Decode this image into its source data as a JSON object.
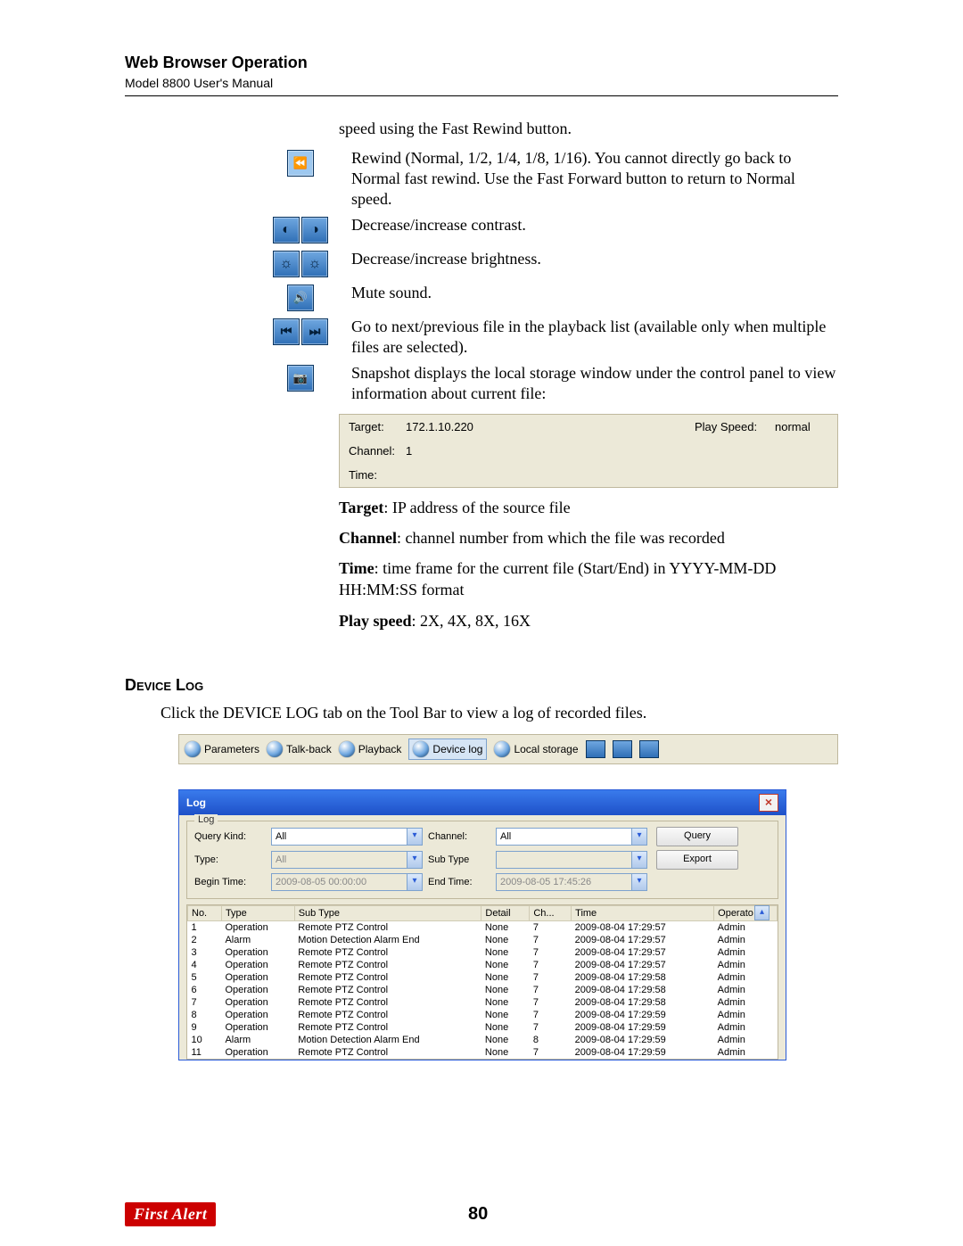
{
  "header": {
    "title": "Web Browser Operation",
    "subtitle": "Model 8800 User's Manual"
  },
  "buttons": {
    "lead_text": "speed using the Fast Rewind button.",
    "rewind_hint": "Rewind (Normal, 1/2, 1/4, 1/8, 1/16). You cannot directly go back to Normal fast rewind. Use the Fast Forward button to return to Normal speed.",
    "contrast": "Decrease/increase contrast.",
    "brightness": "Decrease/increase brightness.",
    "mute": "Mute sound.",
    "nextprev": "Go to next/previous file in the playback list (available only when multiple files are selected).",
    "snapshot": "Snapshot displays the local storage window under the control panel to view information about current file:"
  },
  "snapshot_panel": {
    "target_label": "Target:",
    "target_value": "172.1.10.220",
    "channel_label": "Channel:",
    "channel_value": "1",
    "time_label": "Time:",
    "time_value": "",
    "playspeed_label": "Play Speed:",
    "playspeed_value": "normal"
  },
  "definitions": {
    "target_b": "Target",
    "target_t": ": IP address of the source file",
    "channel_b": "Channel",
    "channel_t": ": channel number from which the file was recorded",
    "time_b": "Time",
    "time_t": ": time frame for the current file (Start/End) in YYYY-MM-DD HH:MM:SS format",
    "play_b": "Play speed",
    "play_t": ": 2X, 4X, 8X, 16X"
  },
  "device_log": {
    "heading": "Device Log",
    "intro": "Click the DEVICE LOG tab on the Tool Bar to view a log of recorded files."
  },
  "toolbar": {
    "parameters": "Parameters",
    "talkback": "Talk-back",
    "playback": "Playback",
    "devicelog": "Device log",
    "localstorage": "Local storage"
  },
  "logwin": {
    "title": "Log",
    "legend": "Log",
    "labels": {
      "query_kind": "Query Kind:",
      "channel": "Channel:",
      "type": "Type:",
      "sub_type": "Sub Type",
      "begin_time": "Begin Time:",
      "end_time": "End Time:"
    },
    "values": {
      "query_kind": "All",
      "channel": "All",
      "type": "All",
      "sub_type": "",
      "begin_time": "2009-08-05 00:00:00",
      "end_time": "2009-08-05 17:45:26"
    },
    "buttons": {
      "query": "Query",
      "export": "Export"
    },
    "columns": {
      "no": "No.",
      "type": "Type",
      "sub": "Sub Type",
      "detail": "Detail",
      "ch": "Ch...",
      "time": "Time",
      "op": "Operato"
    },
    "rows": [
      {
        "no": "1",
        "type": "Operation",
        "sub": "Remote PTZ Control",
        "detail": "None",
        "ch": "7",
        "time": "2009-08-04 17:29:57",
        "op": "Admin"
      },
      {
        "no": "2",
        "type": "Alarm",
        "sub": "Motion Detection Alarm End",
        "detail": "None",
        "ch": "7",
        "time": "2009-08-04 17:29:57",
        "op": "Admin"
      },
      {
        "no": "3",
        "type": "Operation",
        "sub": "Remote PTZ Control",
        "detail": "None",
        "ch": "7",
        "time": "2009-08-04 17:29:57",
        "op": "Admin"
      },
      {
        "no": "4",
        "type": "Operation",
        "sub": "Remote PTZ Control",
        "detail": "None",
        "ch": "7",
        "time": "2009-08-04 17:29:57",
        "op": "Admin"
      },
      {
        "no": "5",
        "type": "Operation",
        "sub": "Remote PTZ Control",
        "detail": "None",
        "ch": "7",
        "time": "2009-08-04 17:29:58",
        "op": "Admin"
      },
      {
        "no": "6",
        "type": "Operation",
        "sub": "Remote PTZ Control",
        "detail": "None",
        "ch": "7",
        "time": "2009-08-04 17:29:58",
        "op": "Admin"
      },
      {
        "no": "7",
        "type": "Operation",
        "sub": "Remote PTZ Control",
        "detail": "None",
        "ch": "7",
        "time": "2009-08-04 17:29:58",
        "op": "Admin"
      },
      {
        "no": "8",
        "type": "Operation",
        "sub": "Remote PTZ Control",
        "detail": "None",
        "ch": "7",
        "time": "2009-08-04 17:29:59",
        "op": "Admin"
      },
      {
        "no": "9",
        "type": "Operation",
        "sub": "Remote PTZ Control",
        "detail": "None",
        "ch": "7",
        "time": "2009-08-04 17:29:59",
        "op": "Admin"
      },
      {
        "no": "10",
        "type": "Alarm",
        "sub": "Motion Detection Alarm End",
        "detail": "None",
        "ch": "8",
        "time": "2009-08-04 17:29:59",
        "op": "Admin"
      },
      {
        "no": "11",
        "type": "Operation",
        "sub": "Remote PTZ Control",
        "detail": "None",
        "ch": "7",
        "time": "2009-08-04 17:29:59",
        "op": "Admin"
      }
    ]
  },
  "footer": {
    "logo": "First Alert",
    "page": "80"
  }
}
